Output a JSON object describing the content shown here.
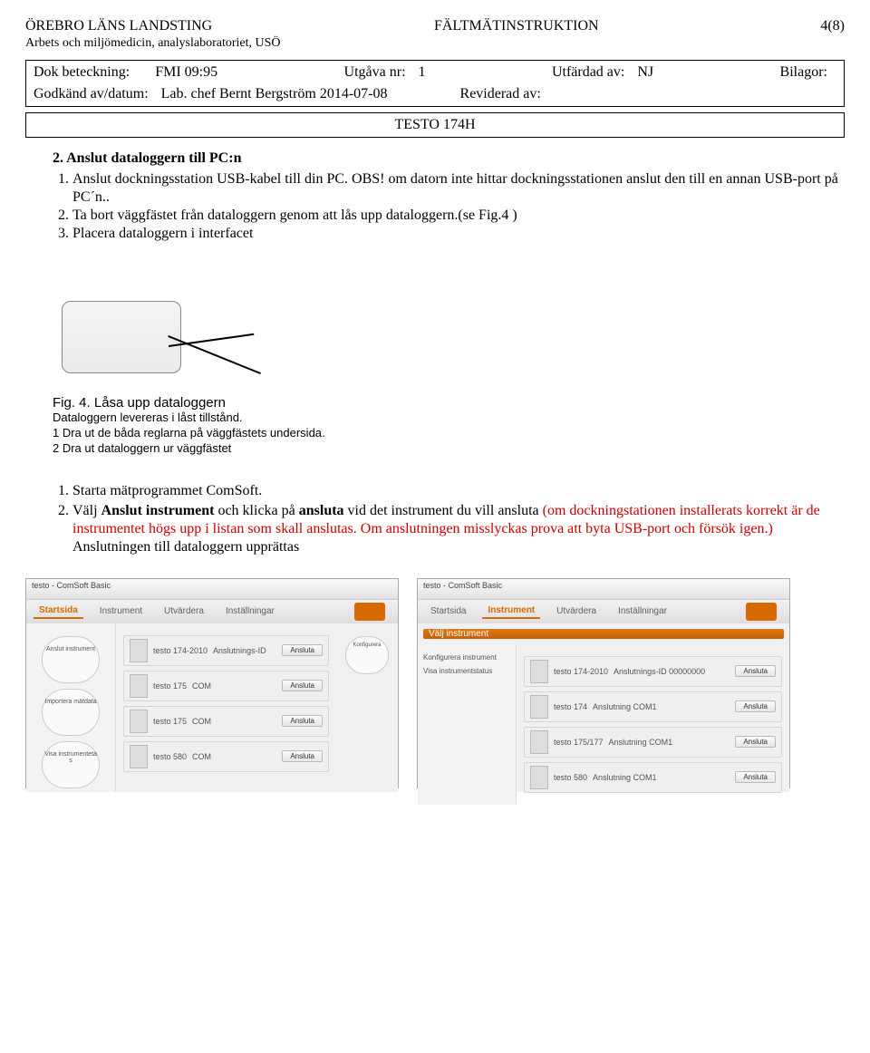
{
  "header": {
    "org": "ÖREBRO LÄNS LANDSTING",
    "doc_type": "FÄLTMÄTINSTRUKTION",
    "page": "4(8)",
    "dept": "Arbets och miljömedicin, analyslaboratoriet, USÖ"
  },
  "docinfo": {
    "dok_label": "Dok beteckning:",
    "dok_val": "FMI 09:95",
    "utgava_label": "Utgåva nr:",
    "utgava_val": "1",
    "utfardad_label": "Utfärdad av:",
    "utfardad_val": "NJ",
    "bilagor_label": "Bilagor:",
    "godkand_label": "Godkänd av/datum:",
    "godkand_val": "Lab. chef Bernt Bergström 2014-07-08",
    "reviderad_label": "Reviderad av:"
  },
  "title": "TESTO 174H",
  "sec2": {
    "heading": "2. Anslut dataloggern till PC:n",
    "items": [
      "Anslut dockningsstation USB-kabel till din PC. OBS! om datorn inte hittar dockningsstationen anslut den till en annan USB-port på PC´n..",
      "Ta bort väggfästet från dataloggern genom att lås upp dataloggern.(se Fig.4 )",
      "Placera dataloggern i interfacet"
    ]
  },
  "fig4": {
    "caption": "Fig. 4. Låsa upp dataloggern",
    "line1": "Dataloggern levereras i låst tillstånd.",
    "line2": "1 Dra ut de båda reglarna på väggfästets undersida.",
    "line3": "2 Dra ut dataloggern ur väggfästet"
  },
  "sec2b": {
    "items_plain": [
      "Starta mätprogrammet ComSoft."
    ],
    "item2_pre": "Välj ",
    "item2_b1": "Anslut instrument",
    "item2_mid": " och klicka på ",
    "item2_b2": "ansluta",
    "item2_post": " vid det instrument du vill ansluta ",
    "item2_red": "(om dockningstationen installerats korrekt är de instrumentet högs upp i listan som skall anslutas. Om anslutningen misslyckas prova att byta USB-port och försök igen.)",
    "item2_tail": " Anslutningen till dataloggern upprättas"
  },
  "app": {
    "title": "testo - ComSoft Basic",
    "tabs": [
      "Startsida",
      "Instrument",
      "Utvärdera",
      "Inställningar"
    ],
    "active_left": 0,
    "active_right": 1,
    "left_bubbles": [
      "Anslut instrument",
      "Importera mätdata",
      "Visa instrumenteta s"
    ],
    "right_bubbles": [
      "Konfigurera instrument",
      "Visa instrumentstatus"
    ],
    "header_strip": "Välj instrument",
    "instruments_left": [
      {
        "name": "testo 174-2010",
        "port": "Anslutnings-ID",
        "btn": "Ansluta"
      },
      {
        "name": "testo 175",
        "port": "COM",
        "btn": "Ansluta"
      },
      {
        "name": "testo 175",
        "port": "COM",
        "btn": "Ansluta"
      },
      {
        "name": "testo 580",
        "port": "COM",
        "btn": "Ansluta"
      }
    ],
    "instruments_right": [
      {
        "name": "testo 174-2010",
        "port": "Anslutnings-ID 00000000",
        "btn": "Ansluta"
      },
      {
        "name": "testo 174",
        "port": "Anslutning COM1",
        "btn": "Ansluta"
      },
      {
        "name": "testo 175/177",
        "port": "Anslutning COM1",
        "btn": "Ansluta"
      },
      {
        "name": "testo 580",
        "port": "Anslutning COM1",
        "btn": "Ansluta"
      }
    ]
  }
}
